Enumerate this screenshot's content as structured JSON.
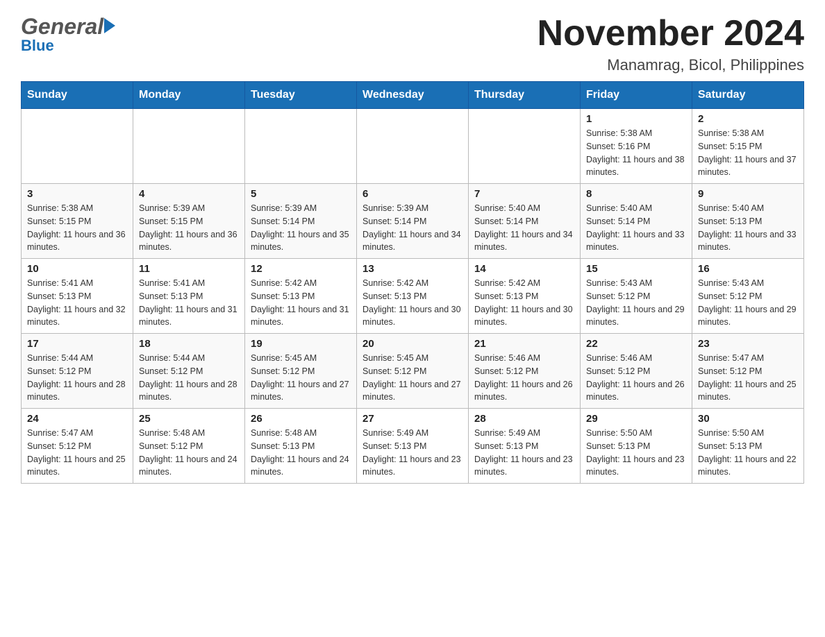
{
  "header": {
    "logo_general": "General",
    "logo_blue": "Blue",
    "month_title": "November 2024",
    "location": "Manamrag, Bicol, Philippines"
  },
  "days_of_week": [
    "Sunday",
    "Monday",
    "Tuesday",
    "Wednesday",
    "Thursday",
    "Friday",
    "Saturday"
  ],
  "weeks": [
    {
      "days": [
        {
          "num": "",
          "info": ""
        },
        {
          "num": "",
          "info": ""
        },
        {
          "num": "",
          "info": ""
        },
        {
          "num": "",
          "info": ""
        },
        {
          "num": "",
          "info": ""
        },
        {
          "num": "1",
          "info": "Sunrise: 5:38 AM\nSunset: 5:16 PM\nDaylight: 11 hours and 38 minutes."
        },
        {
          "num": "2",
          "info": "Sunrise: 5:38 AM\nSunset: 5:15 PM\nDaylight: 11 hours and 37 minutes."
        }
      ]
    },
    {
      "days": [
        {
          "num": "3",
          "info": "Sunrise: 5:38 AM\nSunset: 5:15 PM\nDaylight: 11 hours and 36 minutes."
        },
        {
          "num": "4",
          "info": "Sunrise: 5:39 AM\nSunset: 5:15 PM\nDaylight: 11 hours and 36 minutes."
        },
        {
          "num": "5",
          "info": "Sunrise: 5:39 AM\nSunset: 5:14 PM\nDaylight: 11 hours and 35 minutes."
        },
        {
          "num": "6",
          "info": "Sunrise: 5:39 AM\nSunset: 5:14 PM\nDaylight: 11 hours and 34 minutes."
        },
        {
          "num": "7",
          "info": "Sunrise: 5:40 AM\nSunset: 5:14 PM\nDaylight: 11 hours and 34 minutes."
        },
        {
          "num": "8",
          "info": "Sunrise: 5:40 AM\nSunset: 5:14 PM\nDaylight: 11 hours and 33 minutes."
        },
        {
          "num": "9",
          "info": "Sunrise: 5:40 AM\nSunset: 5:13 PM\nDaylight: 11 hours and 33 minutes."
        }
      ]
    },
    {
      "days": [
        {
          "num": "10",
          "info": "Sunrise: 5:41 AM\nSunset: 5:13 PM\nDaylight: 11 hours and 32 minutes."
        },
        {
          "num": "11",
          "info": "Sunrise: 5:41 AM\nSunset: 5:13 PM\nDaylight: 11 hours and 31 minutes."
        },
        {
          "num": "12",
          "info": "Sunrise: 5:42 AM\nSunset: 5:13 PM\nDaylight: 11 hours and 31 minutes."
        },
        {
          "num": "13",
          "info": "Sunrise: 5:42 AM\nSunset: 5:13 PM\nDaylight: 11 hours and 30 minutes."
        },
        {
          "num": "14",
          "info": "Sunrise: 5:42 AM\nSunset: 5:13 PM\nDaylight: 11 hours and 30 minutes."
        },
        {
          "num": "15",
          "info": "Sunrise: 5:43 AM\nSunset: 5:12 PM\nDaylight: 11 hours and 29 minutes."
        },
        {
          "num": "16",
          "info": "Sunrise: 5:43 AM\nSunset: 5:12 PM\nDaylight: 11 hours and 29 minutes."
        }
      ]
    },
    {
      "days": [
        {
          "num": "17",
          "info": "Sunrise: 5:44 AM\nSunset: 5:12 PM\nDaylight: 11 hours and 28 minutes."
        },
        {
          "num": "18",
          "info": "Sunrise: 5:44 AM\nSunset: 5:12 PM\nDaylight: 11 hours and 28 minutes."
        },
        {
          "num": "19",
          "info": "Sunrise: 5:45 AM\nSunset: 5:12 PM\nDaylight: 11 hours and 27 minutes."
        },
        {
          "num": "20",
          "info": "Sunrise: 5:45 AM\nSunset: 5:12 PM\nDaylight: 11 hours and 27 minutes."
        },
        {
          "num": "21",
          "info": "Sunrise: 5:46 AM\nSunset: 5:12 PM\nDaylight: 11 hours and 26 minutes."
        },
        {
          "num": "22",
          "info": "Sunrise: 5:46 AM\nSunset: 5:12 PM\nDaylight: 11 hours and 26 minutes."
        },
        {
          "num": "23",
          "info": "Sunrise: 5:47 AM\nSunset: 5:12 PM\nDaylight: 11 hours and 25 minutes."
        }
      ]
    },
    {
      "days": [
        {
          "num": "24",
          "info": "Sunrise: 5:47 AM\nSunset: 5:12 PM\nDaylight: 11 hours and 25 minutes."
        },
        {
          "num": "25",
          "info": "Sunrise: 5:48 AM\nSunset: 5:12 PM\nDaylight: 11 hours and 24 minutes."
        },
        {
          "num": "26",
          "info": "Sunrise: 5:48 AM\nSunset: 5:13 PM\nDaylight: 11 hours and 24 minutes."
        },
        {
          "num": "27",
          "info": "Sunrise: 5:49 AM\nSunset: 5:13 PM\nDaylight: 11 hours and 23 minutes."
        },
        {
          "num": "28",
          "info": "Sunrise: 5:49 AM\nSunset: 5:13 PM\nDaylight: 11 hours and 23 minutes."
        },
        {
          "num": "29",
          "info": "Sunrise: 5:50 AM\nSunset: 5:13 PM\nDaylight: 11 hours and 23 minutes."
        },
        {
          "num": "30",
          "info": "Sunrise: 5:50 AM\nSunset: 5:13 PM\nDaylight: 11 hours and 22 minutes."
        }
      ]
    }
  ]
}
